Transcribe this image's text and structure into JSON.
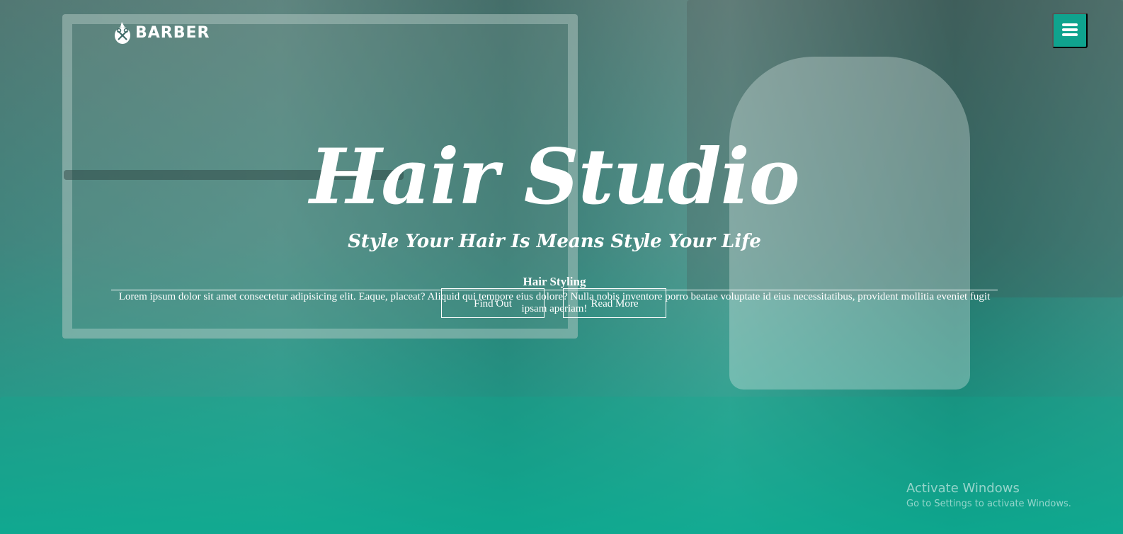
{
  "header": {
    "logo_text": "BARBER",
    "logo_icon": "scissors-comb-icon",
    "menu_icon": "hamburger-menu-icon"
  },
  "hero": {
    "title": "Hair Studio",
    "subtitle": "Style Your Hair Is Means Style Your Life",
    "section_heading": "Hair Styling",
    "paragraph": "Lorem ipsum dolor sit amet consectetur adipisicing elit. Eaque, placeat? Aliquid qui tempore eius dolore? Nulla nobis inventore porro beatae voluptate id eius necessitatibus, provident mollitia eveniet fugit ipsam aperiam!",
    "find_out_label": "Find Out",
    "read_more_label": "Read More"
  },
  "watermark": {
    "title": "Activate Windows",
    "subtitle": "Go to Settings to activate Windows."
  },
  "colors": {
    "accent": "#0fa38e",
    "text": "#ffffff"
  }
}
